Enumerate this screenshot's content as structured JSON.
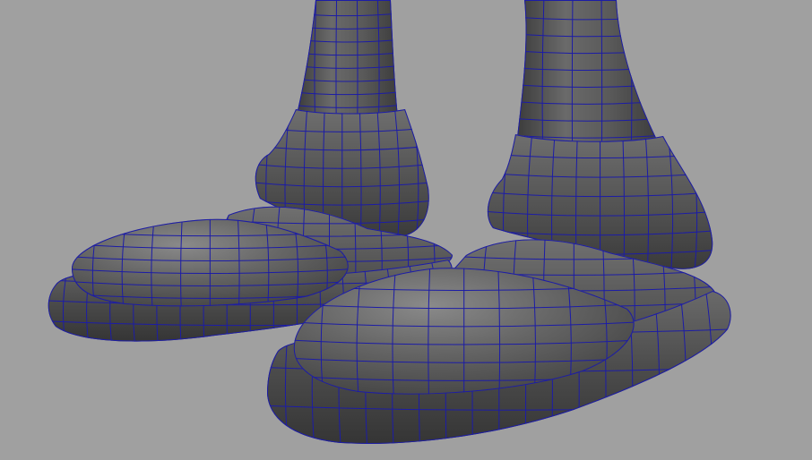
{
  "viewport": {
    "background": "#a0a0a0",
    "shade_dark": "#3e3e3e",
    "shade_mid": "#5c5c5c",
    "shade_light": "#848484",
    "highlight": "#b2b2b2",
    "wire_color": "#1c1ca6"
  },
  "scene": {
    "subject": "wireframe-shaded-3d-cartoon-feet",
    "objects": [
      "left-leg",
      "left-pant-cuff",
      "left-shoe",
      "right-leg",
      "right-pant-cuff",
      "right-shoe"
    ]
  }
}
